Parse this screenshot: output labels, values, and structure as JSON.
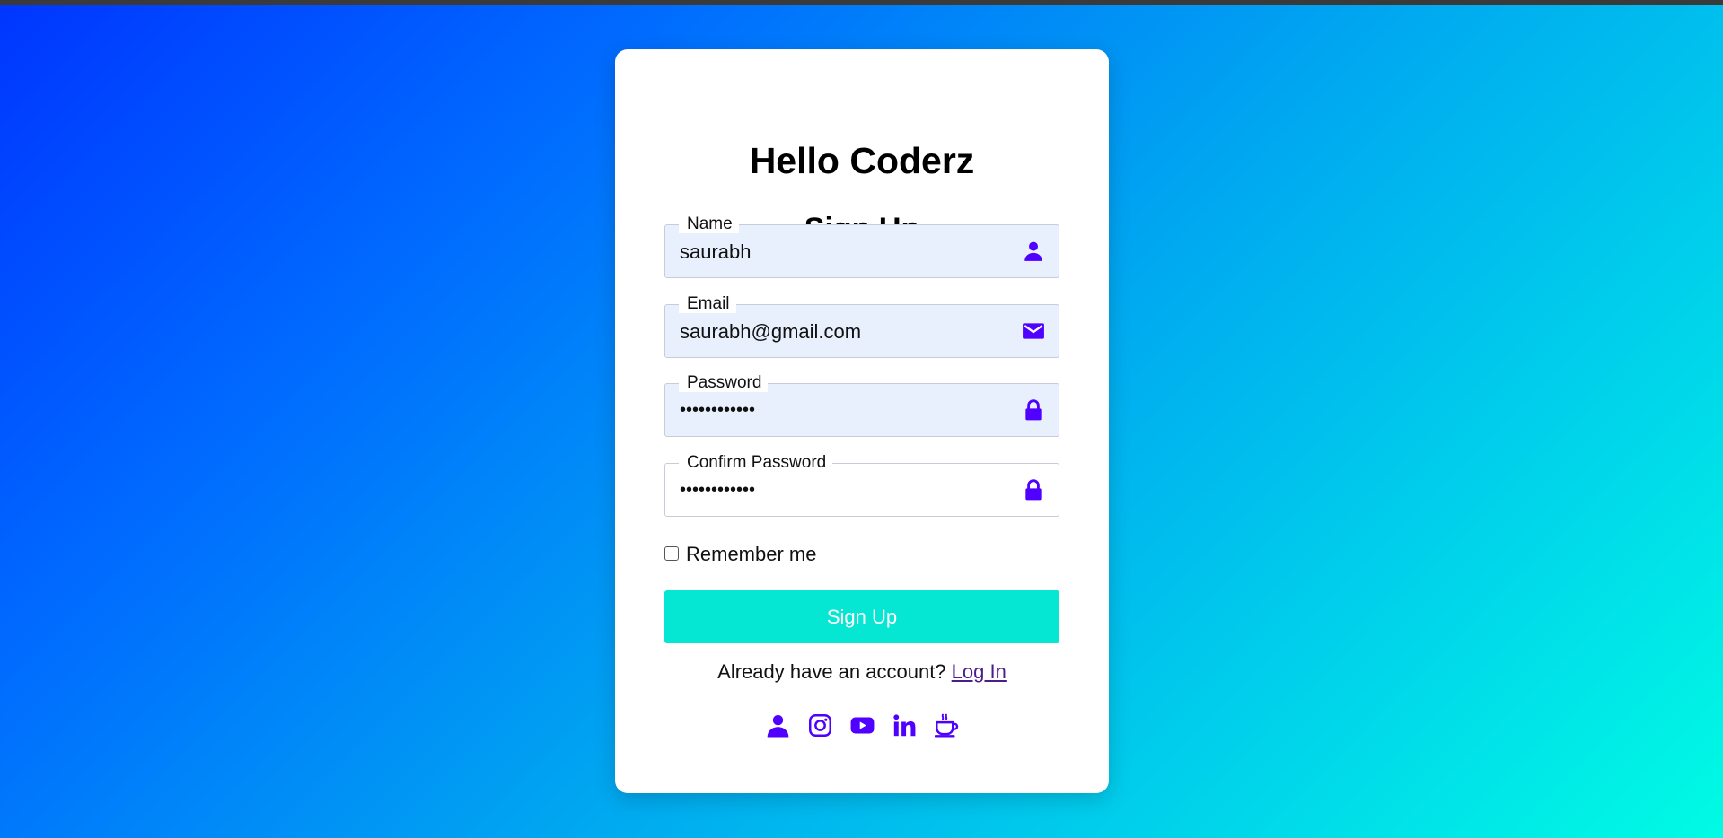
{
  "colors": {
    "accent": "#4f00ff",
    "button": "#05e6d3",
    "link": "#4b1c8c",
    "gradient_start": "#0035ff",
    "gradient_end": "#00fbe4"
  },
  "card": {
    "title": "Hello Coderz",
    "subtitle": "Sign Up"
  },
  "form": {
    "name": {
      "label": "Name",
      "value": "saurabh",
      "icon": "user-icon"
    },
    "email": {
      "label": "Email",
      "value": "saurabh@gmail.com",
      "icon": "envelope-icon"
    },
    "password": {
      "label": "Password",
      "value": "••••••••••••",
      "icon": "lock-icon"
    },
    "confirm_password": {
      "label": "Confirm Password",
      "value": "••••••••••••",
      "icon": "lock-icon"
    },
    "remember_label": "Remember me",
    "remember_checked": false,
    "submit_label": "Sign Up"
  },
  "footer": {
    "prompt": "Already have an account?",
    "login_link": "Log In",
    "socials": [
      "user-icon",
      "instagram-icon",
      "youtube-icon",
      "linkedin-icon",
      "coffee-icon"
    ]
  }
}
